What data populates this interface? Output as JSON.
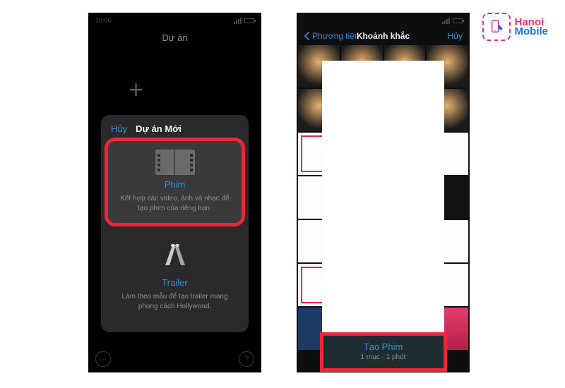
{
  "watermark": {
    "brand_a": "Hanoi",
    "brand_b": "Mobile"
  },
  "left": {
    "statusbar": {
      "time": "10:06"
    },
    "nav_title": "Dự án",
    "sheet": {
      "cancel": "Hủy",
      "title": "Dự án Mới",
      "movie": {
        "label": "Phim",
        "desc": "Kết hợp các video, ảnh và nhạc để tạo phim của riêng bạn."
      },
      "trailer": {
        "label": "Trailer",
        "desc": "Làm theo mẫu để tạo trailer mang phong cách Hollywood."
      }
    }
  },
  "right": {
    "nav": {
      "back": "Phương tiện",
      "title": "Khoảnh khắc",
      "cancel": "Hủy"
    },
    "create": {
      "label": "Tạo Phim",
      "meta": "1 mục · 1 phút"
    }
  }
}
